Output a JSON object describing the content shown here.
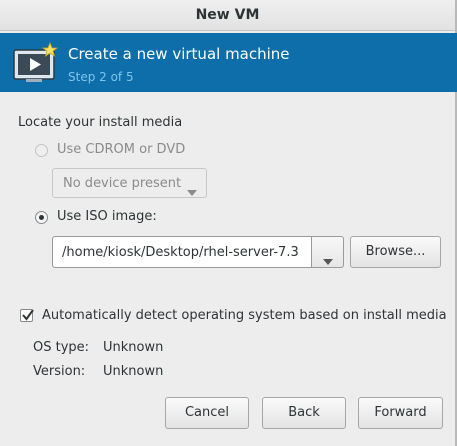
{
  "window": {
    "title": "New VM"
  },
  "banner": {
    "icon": "virtual-machine-icon",
    "title": "Create a new virtual machine",
    "step": "Step 2 of 5"
  },
  "media": {
    "section_label": "Locate your install media",
    "cdrom_label": "Use CDROM or DVD",
    "cdrom_selected": false,
    "cdrom_enabled": false,
    "device_combo_value": "No device present",
    "iso_label": "Use ISO image:",
    "iso_selected": true,
    "iso_path": "/home/kiosk/Desktop/rhel-server-7.3",
    "browse_label": "Browse..."
  },
  "os_detect": {
    "auto_detect_label": "Automatically detect operating system based on install media",
    "auto_detect_checked": true,
    "os_type_label": "OS type:",
    "os_type_value": "Unknown",
    "version_label": "Version:",
    "version_value": "Unknown"
  },
  "buttons": {
    "cancel": "Cancel",
    "back": "Back",
    "forward": "Forward"
  },
  "colors": {
    "banner_bg": "#0d6ea9",
    "step_text": "#7fc4ef"
  }
}
